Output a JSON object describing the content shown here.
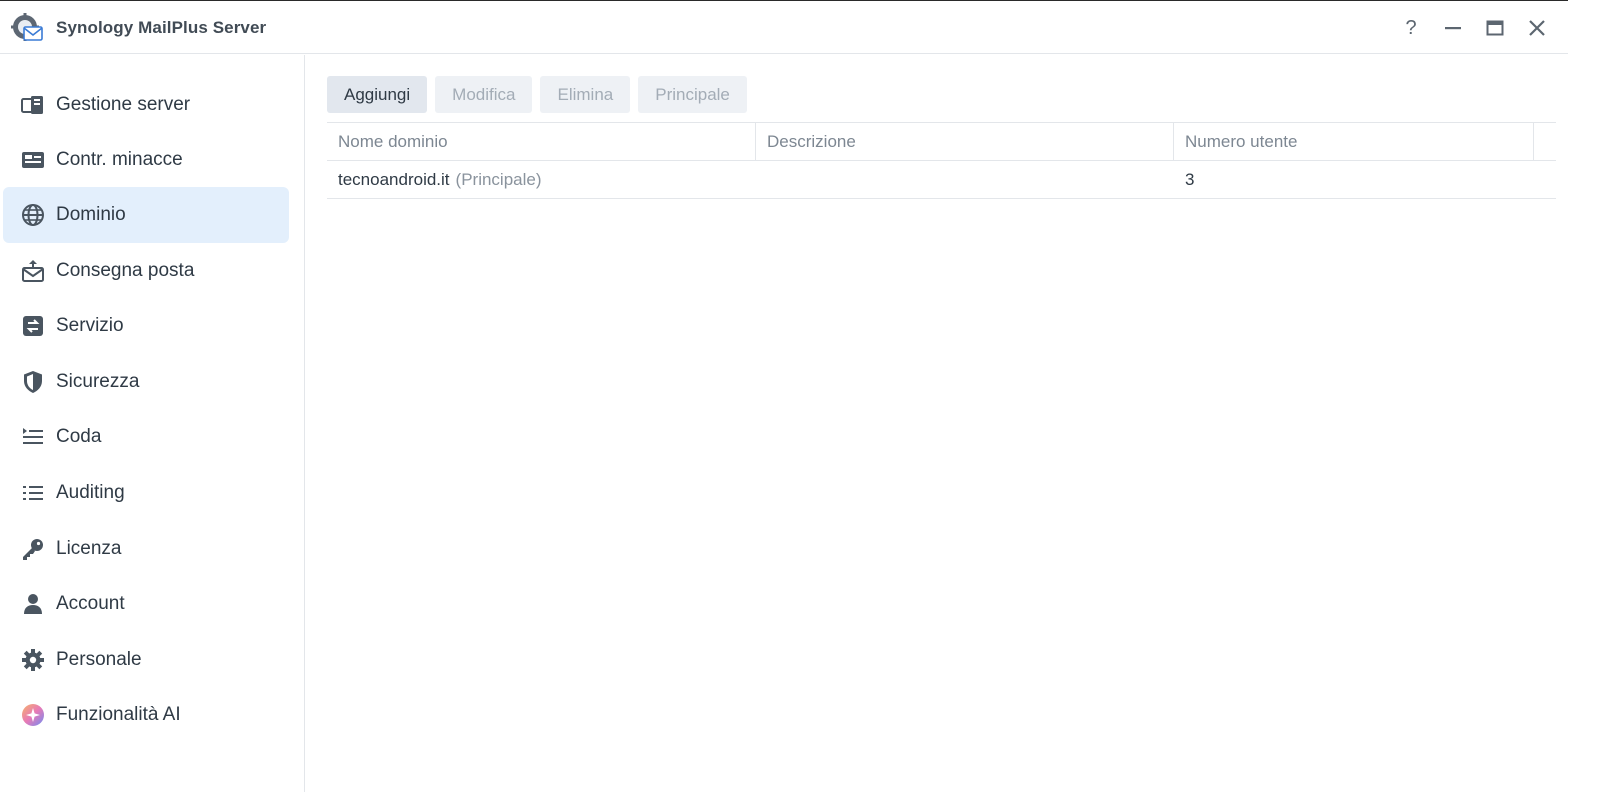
{
  "window": {
    "title": "Synology MailPlus Server",
    "controls": {
      "help": "?",
      "help_icon": "question-icon",
      "minimize_icon": "minimize-icon",
      "maximize_icon": "maximize-icon",
      "close_icon": "close-icon"
    }
  },
  "sidebar": {
    "items": [
      {
        "label": "Gestione server",
        "icon": "server-management-icon"
      },
      {
        "label": "Contr. minacce",
        "icon": "threat-monitor-icon"
      },
      {
        "label": "Dominio",
        "icon": "globe-icon",
        "active": true
      },
      {
        "label": "Consegna posta",
        "icon": "mail-delivery-icon"
      },
      {
        "label": "Servizio",
        "icon": "service-icon"
      },
      {
        "label": "Sicurezza",
        "icon": "shield-icon"
      },
      {
        "label": "Coda",
        "icon": "queue-icon"
      },
      {
        "label": "Auditing",
        "icon": "list-icon"
      },
      {
        "label": "Licenza",
        "icon": "key-icon"
      },
      {
        "label": "Account",
        "icon": "user-icon"
      },
      {
        "label": "Personale",
        "icon": "gear-icon"
      },
      {
        "label": "Funzionalità AI",
        "icon": "ai-sparkle-icon"
      }
    ]
  },
  "toolbar": {
    "add_label": "Aggiungi",
    "edit_label": "Modifica",
    "delete_label": "Elimina",
    "primary_label": "Principale"
  },
  "table": {
    "columns": [
      "Nome dominio",
      "Descrizione",
      "Numero utente"
    ],
    "rows": [
      {
        "domain": "tecnoandroid.it",
        "tag": "(Principale)",
        "description": "",
        "users": "3"
      }
    ]
  },
  "colors": {
    "active_nav": "#e3effc",
    "icon": "#4a5560",
    "button_bg": "#e2e7ee",
    "disabled_text": "#a3acb6"
  }
}
